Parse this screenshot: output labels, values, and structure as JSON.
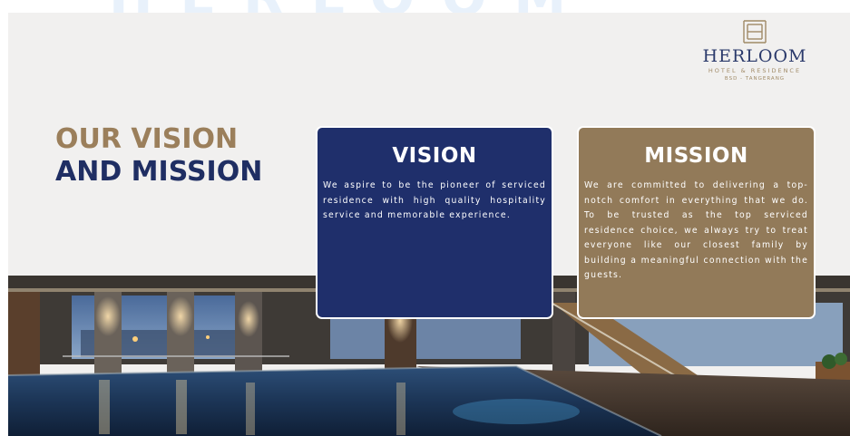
{
  "background_watermark": "HERLOOM",
  "logo": {
    "icon": "herloom-monogram-icon",
    "name": "HERLOOM",
    "subtitle": "HOTEL & RESIDENCE",
    "location": "BSD - TANGERANG"
  },
  "heading": {
    "line1": "OUR VISION",
    "line2": "AND MISSION"
  },
  "vision": {
    "title": "VISION",
    "body": "We aspire to be the pioneer of serviced residence with high quality hospitality service and memorable experience."
  },
  "mission": {
    "title": "MISSION",
    "body": "We are committed to delivering a top-notch comfort in everything that we do. To be trusted as the top serviced residence choice, we always try to treat everyone like our closest family by building a meaningful connection with the guests."
  },
  "photo": {
    "subject": "indoor-pool-photo"
  },
  "colors": {
    "navy": "#1f2f6b",
    "tan": "#927a59",
    "heading_gold": "#9b7f5b",
    "background": "#f1f0ef"
  }
}
